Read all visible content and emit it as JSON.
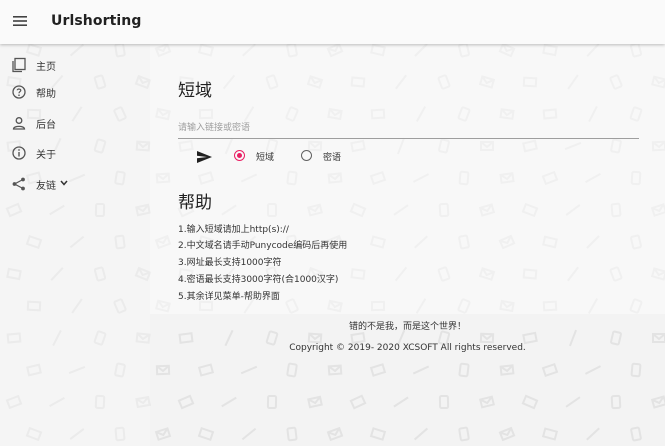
{
  "app": {
    "title": "Urlshorting"
  },
  "sidebar": {
    "items": [
      {
        "label": "主页",
        "icon": "page-copy-icon"
      },
      {
        "label": "帮助",
        "icon": "help-circle-icon"
      },
      {
        "label": "后台",
        "icon": "person-icon"
      },
      {
        "label": "关于",
        "icon": "info-icon"
      },
      {
        "label": "友链",
        "icon": "share-icon"
      }
    ]
  },
  "main": {
    "title": "短域",
    "input_placeholder": "请输入链接或密语",
    "input_value": "",
    "options": {
      "short_label": "短域",
      "secret_label": "密语",
      "selected": "短域"
    },
    "help_title": "帮助",
    "help_lines": [
      "1.输入短域请加上http(s)://",
      "2.中文域名请手动Punycode编码后再使用",
      "3.网址最长支持1000字符",
      "4.密语最长支持3000字符(合1000汉字)",
      "5.其余详见菜单-帮助界面"
    ]
  },
  "footer": {
    "slogan": "错的不是我，而是这个世界！",
    "copyright": "Copyright © 2019- 2020 XCSOFT All rights reserved."
  },
  "colors": {
    "accent": "#e91e63",
    "appbar": "#fafafa",
    "background": "#f3f3f3"
  }
}
